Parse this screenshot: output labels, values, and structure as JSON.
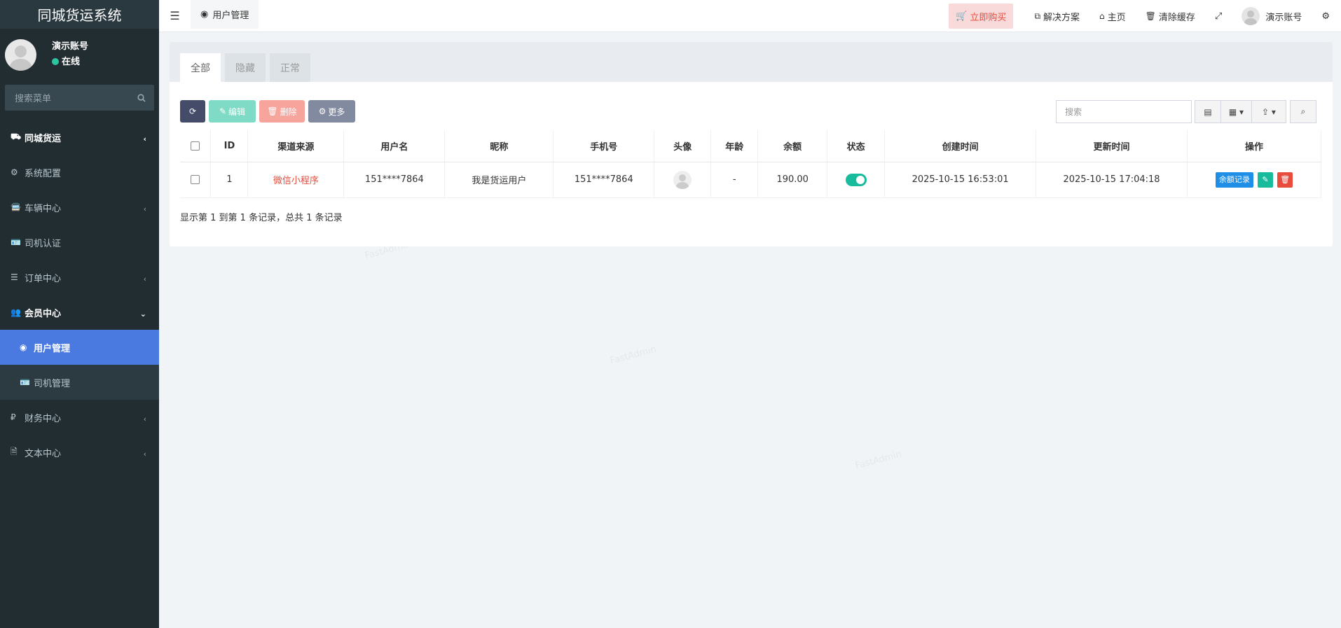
{
  "app": {
    "title": "同城货运系统"
  },
  "user": {
    "name": "演示账号",
    "status": "在线"
  },
  "sidebar": {
    "search_placeholder": "搜索菜单",
    "items": [
      {
        "icon": "truck-icon",
        "glyph": "⛟",
        "label": "同城货运"
      },
      {
        "icon": "gear-icon",
        "glyph": "⚙",
        "label": "系统配置"
      },
      {
        "icon": "car-icon",
        "glyph": "🚍",
        "label": "车辆中心"
      },
      {
        "icon": "id-card-icon",
        "glyph": "🪪",
        "label": "司机认证"
      },
      {
        "icon": "list-icon",
        "glyph": "☰",
        "label": "订单中心"
      },
      {
        "icon": "users-icon",
        "glyph": "👥",
        "label": "会员中心"
      },
      {
        "icon": "user-circle-icon",
        "glyph": "◉",
        "label": "用户管理"
      },
      {
        "icon": "id-card-icon",
        "glyph": "🪪",
        "label": "司机管理"
      },
      {
        "icon": "ruble-icon",
        "glyph": "₽",
        "label": "财务中心"
      },
      {
        "icon": "file-icon",
        "glyph": "🗎",
        "label": "文本中心"
      }
    ]
  },
  "header": {
    "current_tab": "用户管理",
    "buy": "立即购买",
    "solutions": "解决方案",
    "home": "主页",
    "clear_cache": "清除缓存",
    "account": "演示账号"
  },
  "tabs": [
    "全部",
    "隐藏",
    "正常"
  ],
  "toolbar": {
    "edit": "编辑",
    "delete": "删除",
    "more": "更多"
  },
  "search": {
    "placeholder": "搜索"
  },
  "table": {
    "headers": [
      "ID",
      "渠道来源",
      "用户名",
      "昵称",
      "手机号",
      "头像",
      "年龄",
      "余额",
      "状态",
      "创建时间",
      "更新时间",
      "操作"
    ],
    "rows": [
      {
        "id": "1",
        "channel": "微信小程序",
        "username": "151****7864",
        "nickname": "我是货运用户",
        "phone": "151****7864",
        "age": "-",
        "balance": "190.00",
        "status_on": true,
        "created": "2025-10-15 16:53:01",
        "updated": "2025-10-15 17:04:18",
        "balance_btn": "余额记录"
      }
    ]
  },
  "summary": "显示第 1 到第 1 条记录，总共 1 条记录",
  "colors": {
    "sidebar_bg": "#222d32",
    "active": "#4a79e0",
    "accent": "#18bc9c",
    "danger": "#e74c3c"
  }
}
